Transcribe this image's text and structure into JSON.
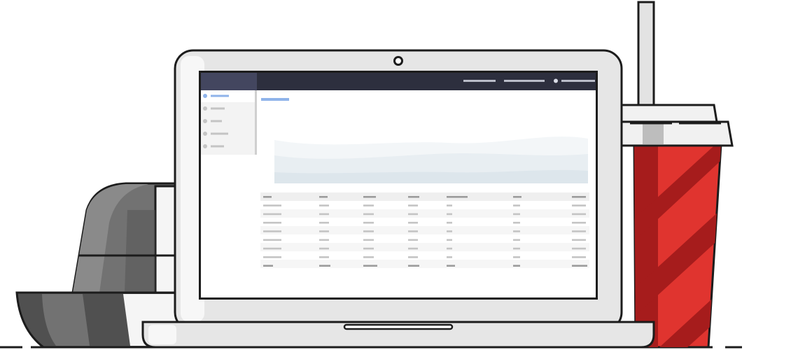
{
  "colors": {
    "outline": "#1c1c1c",
    "laptop_body": "#e6e6e6",
    "laptop_highlight": "#f7f7f7",
    "app_header": "#2d2f3e",
    "app_header_accent": "#43465f",
    "sidebar_bg": "#f3f3f3",
    "sidebar_scroll": "#cfcfcf",
    "accent_blue": "#8fb3ea",
    "placeholder_gray": "#c4c4c4",
    "placeholder_dark": "#9c9c9c",
    "header_line": "#b9bcc8",
    "chart_area_light": "#f3f6f8",
    "chart_area_mid": "#e8eef2",
    "chart_area_dark": "#dde6ec",
    "table_header_bg": "#efefef",
    "table_stripe_bg": "#f6f6f6",
    "cup_red": "#e0342f",
    "cup_stripe": "#a61c1c",
    "cup_lid": "#f1f1f1",
    "cup_lid_shade": "#bdbdbd",
    "straw": "#e3e3e3",
    "cap_dark": "#505050",
    "cap_mid": "#727272",
    "cap_light": "#8a8a8a",
    "cap_white": "#f5f5f5"
  },
  "icons": {
    "webcam": "webcam-icon",
    "sidebar_active_dot": "bullet-dot-icon",
    "sidebar_dot": "bullet-dot-icon",
    "header_status_dot": "status-dot-icon"
  },
  "app": {
    "sidebar": {
      "items": [
        {
          "state": "active"
        },
        {
          "state": "default"
        },
        {
          "state": "default"
        },
        {
          "state": "default"
        },
        {
          "state": "default"
        }
      ]
    },
    "header": {
      "links": [
        "placeholder",
        "placeholder",
        "placeholder"
      ]
    },
    "table": {
      "columns": 7,
      "rows": 7
    }
  }
}
